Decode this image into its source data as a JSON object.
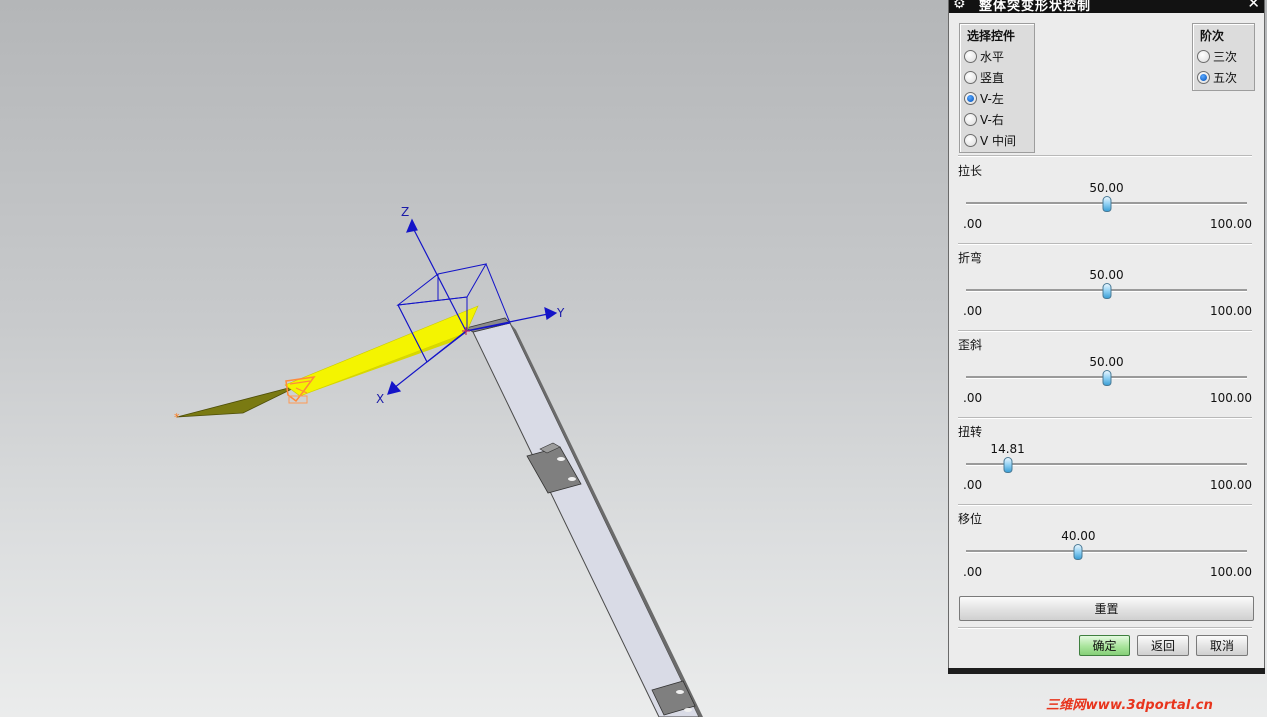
{
  "viewport": {
    "axes": {
      "z": "Z",
      "y": "Y",
      "x": "X"
    }
  },
  "dialog": {
    "title": "整体突变形状控制",
    "select_group": {
      "title": "选择控件",
      "options": [
        "水平",
        "竖直",
        "V-左",
        "V-右",
        "V 中间"
      ],
      "selected": "V-左"
    },
    "order_group": {
      "title": "阶次",
      "options": [
        "三次",
        "五次"
      ],
      "selected": "五次"
    },
    "sliders": [
      {
        "label": "拉长",
        "value_text": "50.00",
        "value": 50.0,
        "min": ".00",
        "max": "100.00"
      },
      {
        "label": "折弯",
        "value_text": "50.00",
        "value": 50.0,
        "min": ".00",
        "max": "100.00"
      },
      {
        "label": "歪斜",
        "value_text": "50.00",
        "value": 50.0,
        "min": ".00",
        "max": "100.00"
      },
      {
        "label": "扭转",
        "value_text": "14.81",
        "value": 14.81,
        "min": ".00",
        "max": "100.00"
      },
      {
        "label": "移位",
        "value_text": "40.00",
        "value": 40.0,
        "min": ".00",
        "max": "100.00"
      }
    ],
    "reset_label": "重置",
    "ok_label": "确定",
    "back_label": "返回",
    "cancel_label": "取消"
  },
  "watermark": "三维网www.3dportal.cn",
  "colors": {
    "ok_button": "#9fe090",
    "radio_selected": "#1a6fd1",
    "surface_yellow": "#f2f200",
    "axis_blue": "#1a1aa8"
  }
}
